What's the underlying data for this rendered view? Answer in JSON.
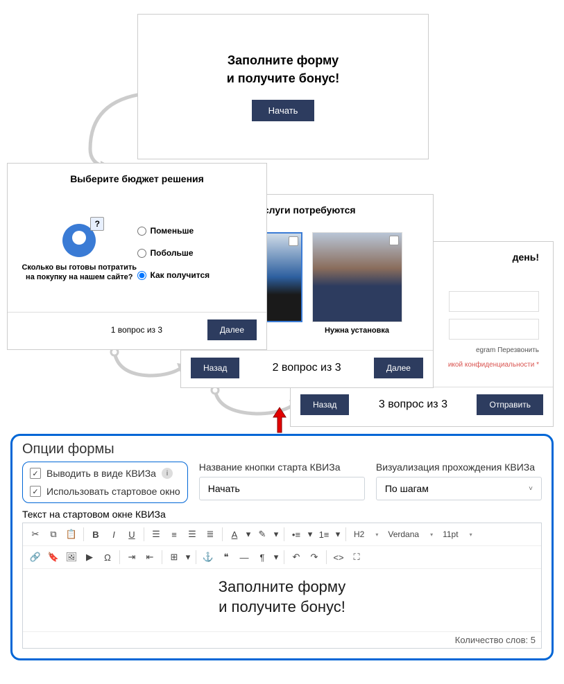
{
  "card1": {
    "title_line1": "Заполните форму",
    "title_line2": "и получите бонус!",
    "button": "Начать"
  },
  "card2": {
    "title": "Выберите бюджет решения",
    "desc": "Сколько вы готовы потратить на покупку на нашем сайте?",
    "options": [
      "Поменьше",
      "Побольше",
      "Как получится"
    ],
    "selected_index": 2,
    "step": "1 вопрос из 3",
    "next": "Далее"
  },
  "card3": {
    "title": "услуги потребуются",
    "option2_label": "Нужна установка",
    "step": "2 вопрос из 3",
    "back": "Назад",
    "next": "Далее"
  },
  "card4": {
    "title": "день!",
    "contact_options": "egram     Перезвонить",
    "policy": "икой конфиденциальности *",
    "step": "3 вопрос из 3",
    "back": "Назад",
    "submit": "Отправить"
  },
  "panel": {
    "title": "Опции формы",
    "checkbox1": "Выводить в виде КВИЗа",
    "checkbox2": "Использовать стартовое окно",
    "field_button_label": "Название кнопки старта КВИЗа",
    "field_button_value": "Начать",
    "field_viz_label": "Визуализация прохождения КВИЗа",
    "field_viz_value": "По шагам",
    "editor_label": "Текст на стартовом окне КВИЗа",
    "editor_line1": "Заполните форму",
    "editor_line2": "и получите бонус!",
    "word_count": "Количество слов: 5",
    "toolbar": {
      "heading": "H2",
      "font": "Verdana",
      "size": "11pt"
    }
  }
}
